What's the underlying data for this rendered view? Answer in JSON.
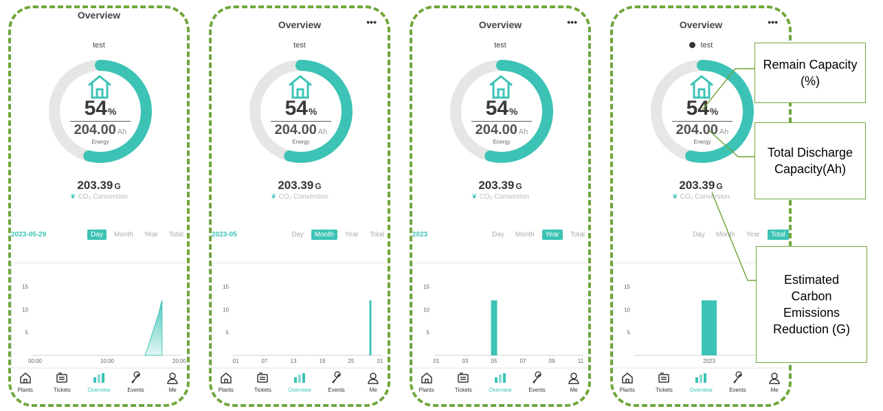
{
  "common": {
    "title": "Overview",
    "more": "•••",
    "plant_name": "test",
    "percent_value": "54",
    "percent_unit": "%",
    "energy_value": "204.00",
    "energy_unit": "Ah",
    "energy_label": "Energy",
    "remain_fraction": 0.54,
    "co2_value": "203.39",
    "co2_unit": "G",
    "co2_label": "CO₂ Conversion",
    "tabs": [
      "Day",
      "Month",
      "Year",
      "Total"
    ],
    "nav": [
      {
        "label": "Plants",
        "icon": "home-icon"
      },
      {
        "label": "Tickets",
        "icon": "ticket-icon"
      },
      {
        "label": "Overview",
        "icon": "bar-chart-icon"
      },
      {
        "label": "Events",
        "icon": "wrench-icon"
      },
      {
        "label": "Me",
        "icon": "person-icon"
      }
    ],
    "accent": "#3cc3b5",
    "dash_color": "#6fa63a"
  },
  "screens": [
    {
      "date": "2023-05-29",
      "active_tab": "Day"
    },
    {
      "date": "2023-05",
      "active_tab": "Month"
    },
    {
      "date": "2023",
      "active_tab": "Year"
    },
    {
      "date": "",
      "active_tab": "Total"
    }
  ],
  "chart_data": [
    {
      "type": "area",
      "title": "",
      "x_tick_labels": [
        "00:00",
        "10:00",
        "20:00"
      ],
      "y_ticks": [
        5,
        10,
        15
      ],
      "ylim": [
        0,
        18
      ],
      "xlim": [
        0,
        24
      ],
      "x": [
        15.2,
        15.6,
        16.0,
        16.4,
        16.8,
        17.2,
        17.5,
        17.6
      ],
      "y": [
        0,
        1.5,
        3.5,
        5.5,
        7.5,
        9.5,
        11.5,
        12
      ]
    },
    {
      "type": "bar",
      "title": "",
      "x_tick_labels": [
        "01",
        "07",
        "13",
        "19",
        "25",
        "31"
      ],
      "y_ticks": [
        5,
        10,
        15
      ],
      "ylim": [
        0,
        18
      ],
      "categories": [
        "29"
      ],
      "values": [
        12
      ]
    },
    {
      "type": "bar",
      "title": "",
      "x_tick_labels": [
        "01",
        "03",
        "05",
        "07",
        "09",
        "11"
      ],
      "y_ticks": [
        5,
        10,
        15
      ],
      "ylim": [
        0,
        18
      ],
      "categories": [
        "05"
      ],
      "values": [
        12
      ]
    },
    {
      "type": "bar",
      "title": "",
      "x_tick_labels": [
        "2023"
      ],
      "y_ticks": [
        5,
        10,
        15
      ],
      "ylim": [
        0,
        18
      ],
      "categories": [
        "2023"
      ],
      "values": [
        12
      ]
    }
  ],
  "callouts": {
    "remain": "Remain Capacity (%)",
    "total": "Total Discharge Capacity(Ah)",
    "carbon": "Estimated Carbon Emissions Reduction (G)"
  }
}
